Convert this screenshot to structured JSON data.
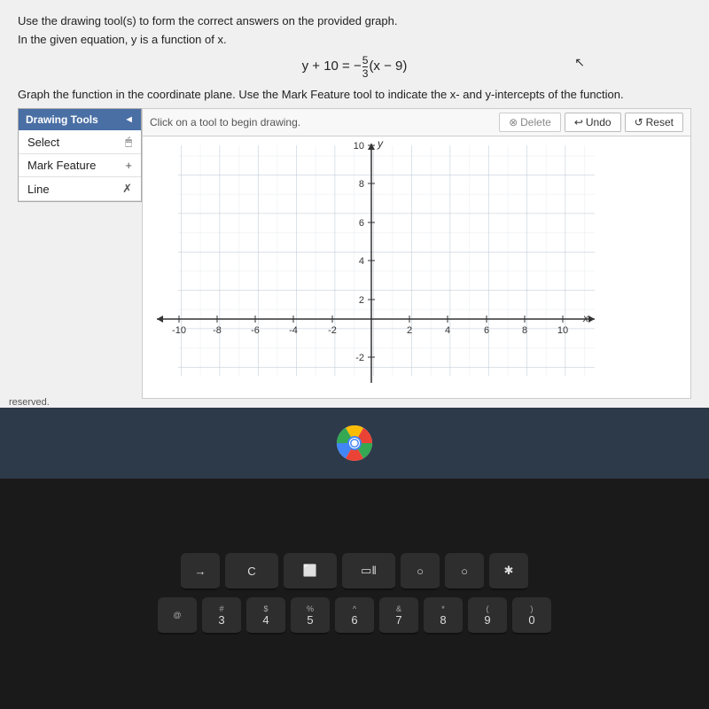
{
  "page": {
    "instruction1": "Use the drawing tool(s) to form the correct answers on the provided graph.",
    "instruction2": "In the given equation, y is a function of x.",
    "equation": "y + 10 = −⁵⁄₃(x − 9)",
    "graph_instruction": "Graph the function in the coordinate plane. Use the Mark Feature tool to indicate the x- and y-intercepts of the function.",
    "reserved_text": "reserved."
  },
  "drawing_tools": {
    "header": "Drawing Tools",
    "collapse_label": "◄",
    "tools": [
      {
        "label": "Select",
        "icon": "🖱",
        "id": "select"
      },
      {
        "label": "Mark Feature",
        "icon": "+",
        "id": "mark-feature"
      },
      {
        "label": "Line",
        "icon": "✗",
        "id": "line"
      }
    ]
  },
  "toolbar": {
    "hint": "Click on a tool to begin drawing.",
    "delete_label": "Delete",
    "undo_label": "Undo",
    "reset_label": "Reset"
  },
  "graph": {
    "x_min": -10,
    "x_max": 10,
    "y_min": -2,
    "y_max": 10,
    "x_axis_labels": [
      "-10",
      "-8",
      "-6",
      "-4",
      "-2",
      "",
      "2",
      "4",
      "6",
      "8",
      "10"
    ],
    "y_axis_labels": [
      "10",
      "8",
      "6",
      "4",
      "2",
      "-2"
    ],
    "x_label": "x",
    "y_label": "y"
  },
  "keyboard": {
    "rows": [
      [
        {
          "top": "",
          "main": "→"
        },
        {
          "top": "",
          "main": "C"
        },
        {
          "top": "",
          "main": "⬜"
        },
        {
          "top": "",
          "main": "⬜‖"
        },
        {
          "top": "",
          "main": "○"
        },
        {
          "top": "",
          "main": "○"
        },
        {
          "top": "",
          "main": "✱"
        }
      ],
      [
        {
          "top": "@",
          "main": ""
        },
        {
          "top": "#",
          "main": "3"
        },
        {
          "top": "$",
          "main": "4"
        },
        {
          "top": "%",
          "main": "5"
        },
        {
          "top": "^",
          "main": "6"
        },
        {
          "top": "&",
          "main": "7"
        },
        {
          "top": "*",
          "main": "8"
        },
        {
          "top": "(",
          "main": "9"
        },
        {
          "top": ")",
          "main": "0"
        }
      ]
    ]
  }
}
